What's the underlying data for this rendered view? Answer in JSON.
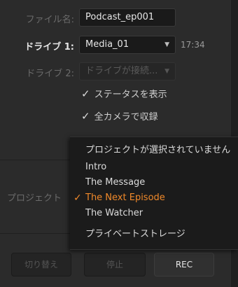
{
  "form": {
    "filename_label": "ファイル名:",
    "filename_value": "Podcast_ep001",
    "drive1_label": "ドライブ 1:",
    "drive1_value": "Media_01",
    "drive1_time": "17:34",
    "drive2_label": "ドライブ 2:",
    "drive2_value": "ドライブが接続...",
    "chevron": "▼",
    "project_label": "プロジェクト",
    "checkbox_tick": "✓",
    "checks": [
      {
        "label": "ステータスを表示",
        "checked": true
      },
      {
        "label": "全カメラで収録",
        "checked": true
      }
    ]
  },
  "dropdown": {
    "check_glyph": "✓",
    "items": [
      {
        "label": "プロジェクトが選択されていません",
        "selected": false
      },
      {
        "label": "Intro",
        "selected": false
      },
      {
        "label": "The Message",
        "selected": false
      },
      {
        "label": "The Next Episode",
        "selected": true
      },
      {
        "label": "The Watcher",
        "selected": false
      },
      {
        "label": "プライベートストレージ",
        "selected": false
      }
    ]
  },
  "buttons": {
    "switch": "切り替え",
    "stop": "停止",
    "rec": "REC"
  },
  "colors": {
    "accent": "#f0892a",
    "panel": "#2b2b2b"
  }
}
